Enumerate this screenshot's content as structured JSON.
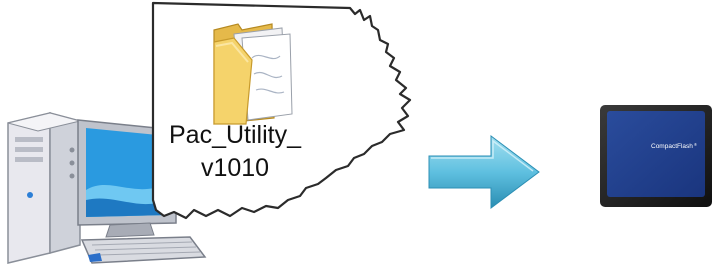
{
  "folder": {
    "name_line1": "Pac_Utility_",
    "name_line2": "v1010"
  },
  "card": {
    "brand_text": "CompactFlash"
  },
  "icons": [
    "desktop-computer-icon",
    "folder-icon",
    "arrow-right-icon",
    "compactflash-card-icon"
  ],
  "colors": {
    "arrow_light": "#8fd6ea",
    "arrow_dark": "#2a9cbf",
    "card_blue": "#1f3d8c",
    "folder_yellow": "#f5d36b"
  }
}
